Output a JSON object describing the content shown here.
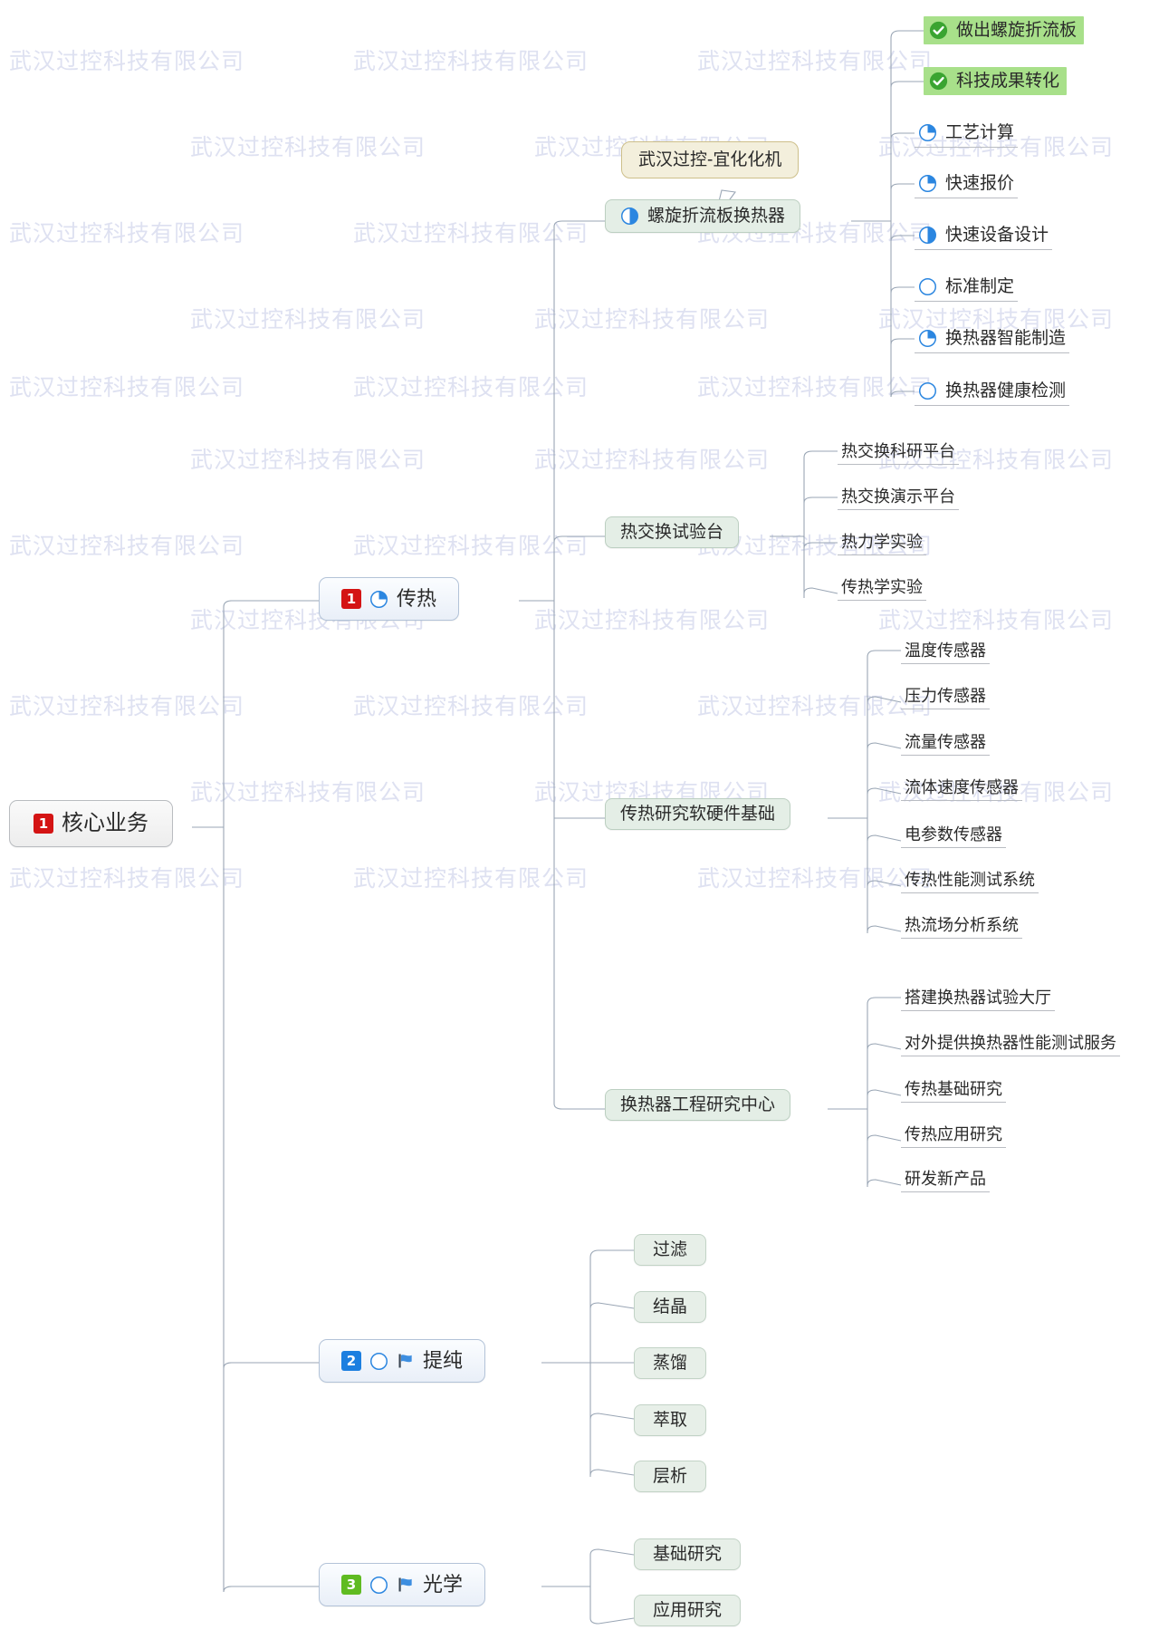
{
  "document": {
    "type": "mind-map",
    "title": "核心业务",
    "watermark_text": "武汉过控科技有限公司"
  },
  "colors": {
    "priority_1": "#d41414",
    "priority_2": "#1c7fe0",
    "priority_3": "#5fbb21",
    "progress_blue": "#2b86e0",
    "done_green": "#3aa431",
    "highlight_green": "#a8e08a",
    "mint_node": "#e4eee6",
    "callout_bg": "#f3efdc",
    "callout_border": "#cdbf8a",
    "lvl1_bg": "#eef3fa",
    "connector": "#9aa6b5",
    "watermark": "#d9dcef"
  },
  "root": {
    "label": "核心业务",
    "priority": "1"
  },
  "callout": {
    "label": "武汉过控-宜化化机"
  },
  "branches": [
    {
      "label": "传热",
      "priority": "1",
      "progress": "25",
      "children": [
        {
          "label": "螺旋折流板换热器",
          "progress": "50",
          "children": [
            {
              "label": "做出螺旋折流板",
              "progress": "100",
              "highlight": true
            },
            {
              "label": "科技成果转化",
              "progress": "100",
              "highlight": true
            },
            {
              "label": "工艺计算",
              "progress": "25"
            },
            {
              "label": "快速报价",
              "progress": "25"
            },
            {
              "label": "快速设备设计",
              "progress": "50"
            },
            {
              "label": "标准制定",
              "progress": "0"
            },
            {
              "label": "换热器智能制造",
              "progress": "25"
            },
            {
              "label": "换热器健康检测",
              "progress": "0"
            }
          ]
        },
        {
          "label": "热交换试验台",
          "children": [
            {
              "label": "热交换科研平台"
            },
            {
              "label": "热交换演示平台"
            },
            {
              "label": "热力学实验"
            },
            {
              "label": "传热学实验"
            }
          ]
        },
        {
          "label": "传热研究软硬件基础",
          "children": [
            {
              "label": "温度传感器"
            },
            {
              "label": "压力传感器"
            },
            {
              "label": "流量传感器"
            },
            {
              "label": "流体速度传感器"
            },
            {
              "label": "电参数传感器"
            },
            {
              "label": "传热性能测试系统"
            },
            {
              "label": "热流场分析系统"
            }
          ]
        },
        {
          "label": "换热器工程研究中心",
          "children": [
            {
              "label": "搭建换热器试验大厅"
            },
            {
              "label": "对外提供换热器性能测试服务"
            },
            {
              "label": "传热基础研究"
            },
            {
              "label": "传热应用研究"
            },
            {
              "label": "研发新产品"
            }
          ]
        }
      ]
    },
    {
      "label": "提纯",
      "priority": "2",
      "progress": "0",
      "flag": true,
      "children": [
        {
          "label": "过滤"
        },
        {
          "label": "结晶"
        },
        {
          "label": "蒸馏"
        },
        {
          "label": "萃取"
        },
        {
          "label": "层析"
        }
      ]
    },
    {
      "label": "光学",
      "priority": "3",
      "progress": "0",
      "flag": true,
      "children": [
        {
          "label": "基础研究"
        },
        {
          "label": "应用研究"
        }
      ]
    }
  ]
}
